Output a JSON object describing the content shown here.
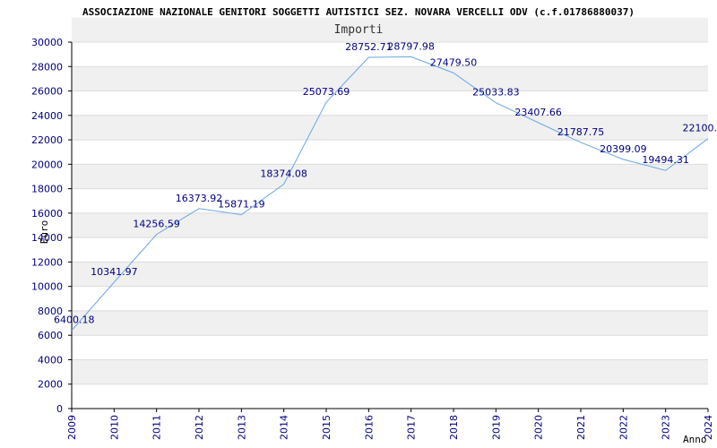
{
  "chart_data": {
    "type": "line",
    "title": "ASSOCIAZIONE NAZIONALE GENITORI SOGGETTI AUTISTICI SEZ. NOVARA VERCELLI ODV (c.f.01786880037)",
    "subtitle": "Importi",
    "xlabel": "Anno",
    "ylabel": "Euro",
    "ylim": [
      0,
      30000
    ],
    "y_ticks": [
      "0",
      "2000",
      "4000",
      "6000",
      "8000",
      "10000",
      "12000",
      "14000",
      "16000",
      "18000",
      "20000",
      "22000",
      "24000",
      "26000",
      "28000",
      "30000"
    ],
    "categories": [
      "2009",
      "2010",
      "2011",
      "2012",
      "2013",
      "2014",
      "2015",
      "2016",
      "2017",
      "2018",
      "2019",
      "2020",
      "2021",
      "2022",
      "2023",
      "2024"
    ],
    "values": [
      6400.18,
      10341.97,
      14256.59,
      16373.92,
      15871.19,
      18374.08,
      25073.69,
      28752.71,
      28797.98,
      27479.5,
      25033.83,
      23407.66,
      21787.75,
      20399.09,
      19494.31,
      22100
    ],
    "value_labels": [
      "6400.18",
      "10341.97",
      "14256.59",
      "16373.92",
      "15871.19",
      "18374.08",
      "25073.69",
      "28752.71",
      "28797.98",
      "27479.50",
      "25033.83",
      "23407.66",
      "21787.75",
      "20399.09",
      "19494.31",
      "22100."
    ],
    "line_color": "#6aa7e6",
    "band_color": "#f0f0f0",
    "grid": true,
    "legend": "none"
  }
}
